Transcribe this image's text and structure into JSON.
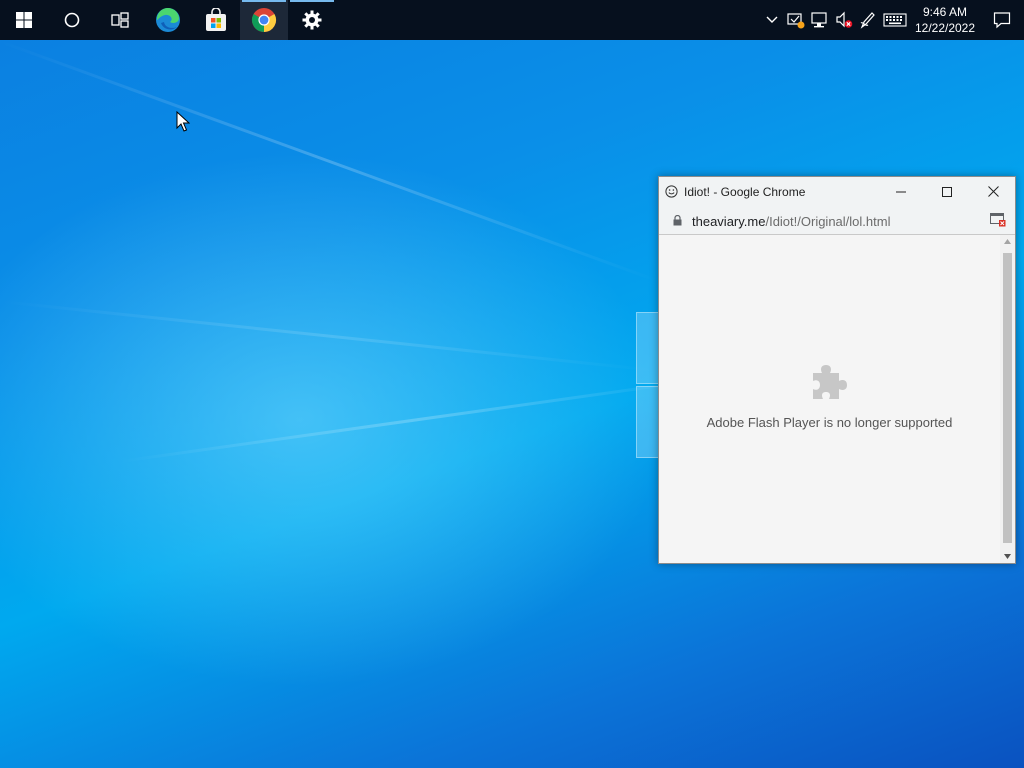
{
  "taskbar": {
    "apps": [
      {
        "name": "start",
        "icon": "windows-logo-icon"
      },
      {
        "name": "search",
        "icon": "cortana-circle-icon"
      },
      {
        "name": "task-view",
        "icon": "task-view-icon"
      },
      {
        "name": "edge",
        "icon": "edge-icon"
      },
      {
        "name": "store",
        "icon": "store-bag-icon"
      },
      {
        "name": "chrome",
        "icon": "chrome-icon",
        "running": true,
        "active": true
      },
      {
        "name": "settings",
        "icon": "gear-icon",
        "running": true
      }
    ],
    "tray": {
      "icons": [
        "chevron-up-icon",
        "security-warning-icon",
        "network-icon",
        "volume-muted-icon",
        "pen-icon",
        "keyboard-icon"
      ],
      "time": "9:46 AM",
      "date": "12/22/2022"
    }
  },
  "window": {
    "title": "Idiot! - Google Chrome",
    "url_domain": "theaviary.me",
    "url_path": "/Idiot!/Original/lol.html",
    "message": "Adobe Flash Player is no longer supported"
  },
  "colors": {
    "taskbar": "#06101e",
    "accent": "#76b9ed",
    "desktop_blue": "#0a8fe8"
  }
}
